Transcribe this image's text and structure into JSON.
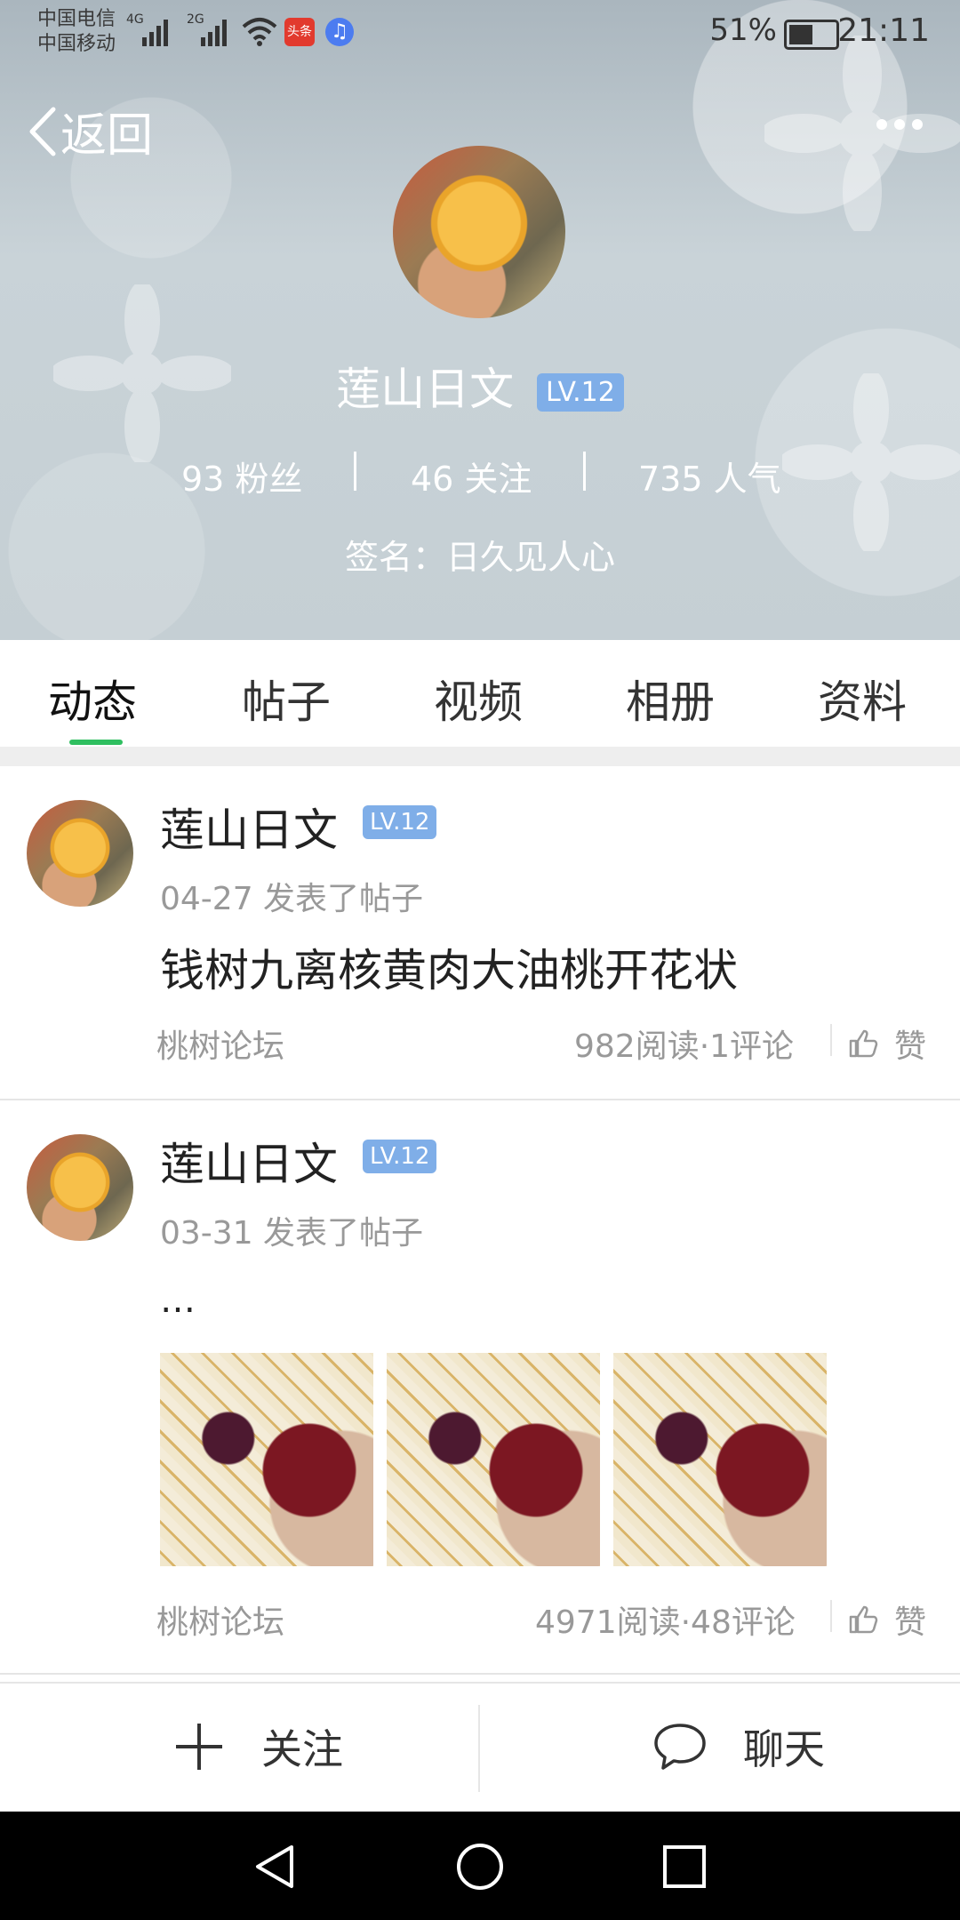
{
  "status_bar": {
    "carrier1": "中国电信",
    "carrier2": "中国移动",
    "net1": "4G",
    "net2": "2G",
    "app_badge": "头条",
    "battery_pct": "51%",
    "time": "21:11"
  },
  "header": {
    "back_label": "返回",
    "user_name": "莲山日文",
    "level": "LV.12",
    "fans": "93 粉丝",
    "following": "46 关注",
    "popularity": "735 人气",
    "signature": "签名：日久见人心"
  },
  "tabs": [
    {
      "label": "动态"
    },
    {
      "label": "帖子"
    },
    {
      "label": "视频"
    },
    {
      "label": "相册"
    },
    {
      "label": "资料"
    }
  ],
  "posts": [
    {
      "user": "莲山日文",
      "level": "LV.12",
      "date_action": "04-27  发表了帖子",
      "title": "钱树九离核黄肉大油桃开花状",
      "forum": "桃树论坛",
      "stats": "982阅读·1评论",
      "like_label": "赞"
    },
    {
      "user": "莲山日文",
      "level": "LV.12",
      "date_action": "03-31  发表了帖子",
      "title": "…",
      "forum": "桃树论坛",
      "stats": "4971阅读·48评论",
      "like_label": "赞",
      "images": [
        "peach-photo-1",
        "peach-photo-2",
        "peach-photo-3"
      ]
    }
  ],
  "bottom_bar": {
    "follow_label": "关注",
    "chat_label": "聊天"
  },
  "colors": {
    "accent": "#2fbf60",
    "level_badge": "#7faee8"
  }
}
